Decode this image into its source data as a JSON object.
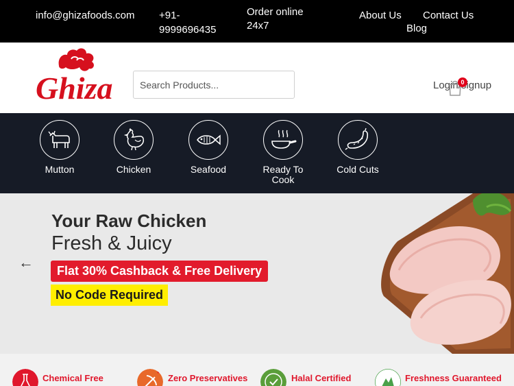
{
  "topbar": {
    "email": "info@ghizafoods.com",
    "phone": "+91-9999696435",
    "order": "Order online 24x7",
    "about": "About Us",
    "contact": "Contact Us",
    "blog": "Blog"
  },
  "header": {
    "logo_text": "Ghiza",
    "search_placeholder": "Search Products...",
    "login": "Login/signup",
    "cart_count": "0",
    "brand_color": "#d6101e"
  },
  "categories": [
    {
      "label": "Mutton",
      "icon": "goat-icon"
    },
    {
      "label": "Chicken",
      "icon": "chicken-icon"
    },
    {
      "label": "Seafood",
      "icon": "fish-icon"
    },
    {
      "label": "Ready To Cook",
      "icon": "frying-pan-icon"
    },
    {
      "label": "Cold Cuts",
      "icon": "sausage-icon"
    }
  ],
  "hero": {
    "title": "Your Raw Chicken",
    "subtitle": "Fresh & Juicy",
    "offer": "Flat 30% Cashback & Free Delivery",
    "code": "No Code Required",
    "prev_arrow": "←"
  },
  "features": [
    {
      "title": "Chemical Free",
      "icon": "flask-icon",
      "color": "#e0172c"
    },
    {
      "title": "Zero Preservatives",
      "icon": "no-preservatives-icon",
      "color": "#e8692a"
    },
    {
      "title": "Halal Certified",
      "icon": "halal-icon",
      "color": "#5a9e3a"
    },
    {
      "title": "Freshness Guaranteed",
      "icon": "fresh-icon",
      "color": "#4aa14a"
    }
  ]
}
